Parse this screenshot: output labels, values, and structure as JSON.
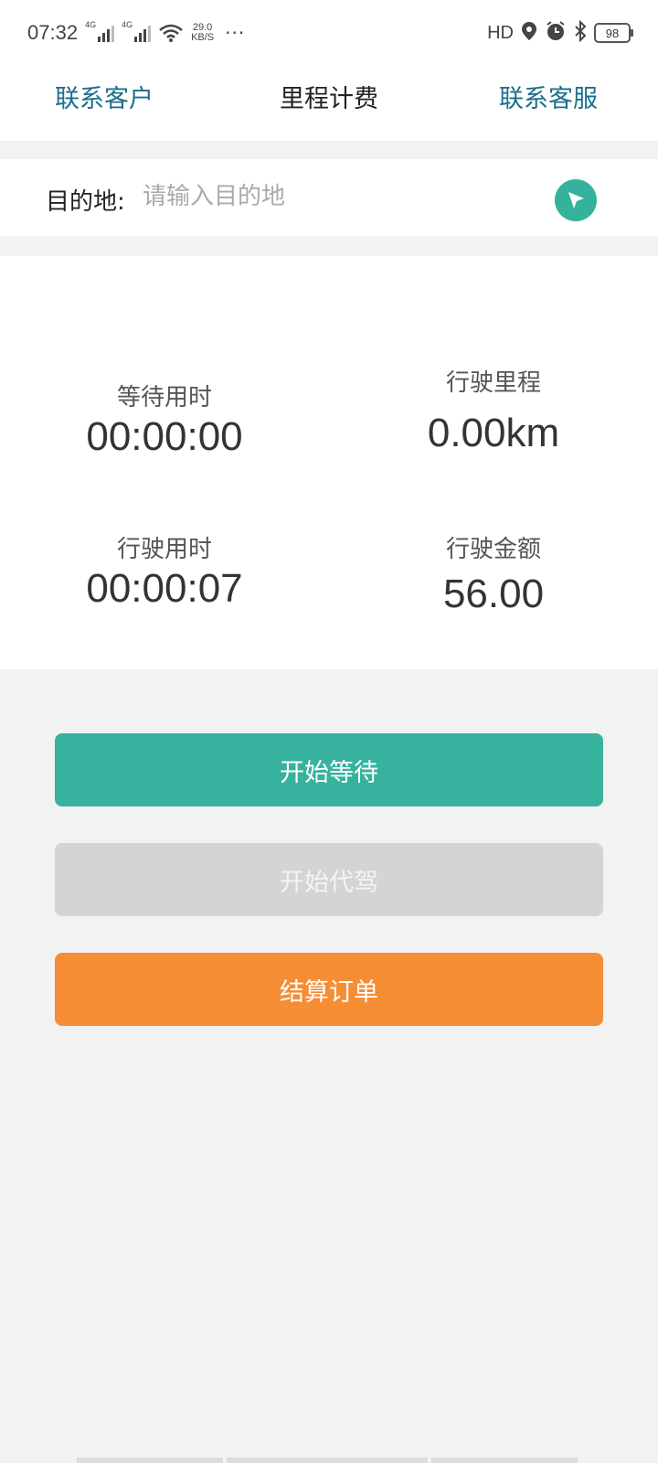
{
  "status_bar": {
    "time": "07:32",
    "signal1": "4G",
    "signal2": "4G",
    "speed_value": "29.0",
    "speed_unit": "KB/S",
    "more": "···",
    "hd": "HD",
    "battery": "98"
  },
  "navbar": {
    "left_link": "联系客户",
    "title": "里程计费",
    "right_link": "联系客服"
  },
  "destination": {
    "label": "目的地:",
    "value": "",
    "placeholder": "请输入目的地",
    "nav_icon": "navigation-arrow-icon"
  },
  "stats": {
    "wait_time_label": "等待用时",
    "wait_time_value": "00:00:00",
    "distance_label": "行驶里程",
    "distance_value": "0.00km",
    "drive_time_label": "行驶用时",
    "drive_time_value": "00:00:07",
    "amount_label": "行驶金额",
    "amount_value": "56.00"
  },
  "buttons": {
    "start_wait": "开始等待",
    "start_drive": "开始代驾",
    "settle_order": "结算订单"
  },
  "colors": {
    "primary_teal": "#37b29e",
    "disabled_gray": "#d4d4d4",
    "settle_orange": "#f58d35",
    "link_blue": "#1c6e8c"
  }
}
